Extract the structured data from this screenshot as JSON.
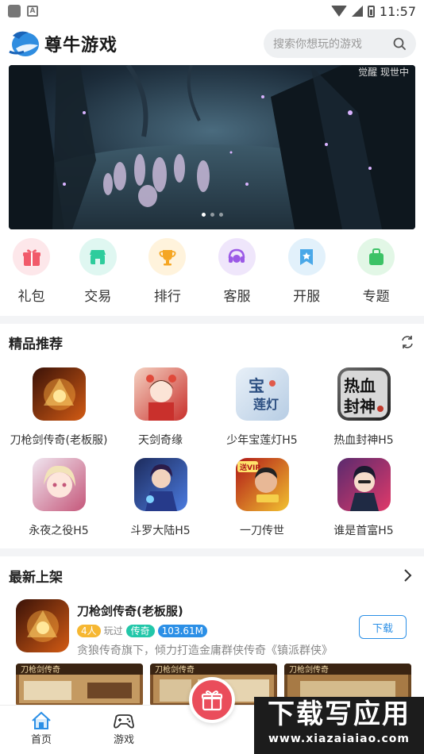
{
  "status_bar": {
    "time": "11:57"
  },
  "header": {
    "app_name": "尊牛游戏",
    "search_placeholder": "搜索你想玩的游戏"
  },
  "banner": {
    "tag": "觉醒 现世中",
    "slide_count": 3,
    "active_slide": 1
  },
  "quick_nav": [
    {
      "label": "礼包",
      "icon": "gift-icon",
      "bg": "#fde7ea",
      "fg": "#f15a6a"
    },
    {
      "label": "交易",
      "icon": "shop-icon",
      "bg": "#dff7f1",
      "fg": "#2ecc9c"
    },
    {
      "label": "排行",
      "icon": "trophy-icon",
      "bg": "#fff3dc",
      "fg": "#f5a623"
    },
    {
      "label": "客服",
      "icon": "headset-icon",
      "bg": "#efe6fb",
      "fg": "#9b59e6"
    },
    {
      "label": "开服",
      "icon": "bookmark-icon",
      "bg": "#e2f1fb",
      "fg": "#4aa8e8"
    },
    {
      "label": "专题",
      "icon": "bag-icon",
      "bg": "#e2f7e6",
      "fg": "#3cc266"
    }
  ],
  "recommended": {
    "title": "精品推荐",
    "games": [
      {
        "name": "刀枪剑传奇(老板服)",
        "colors": [
          "#3a1208",
          "#d35b14"
        ]
      },
      {
        "name": "天剑奇缘",
        "colors": [
          "#f4d2c2",
          "#c9302c"
        ]
      },
      {
        "name": "少年宝莲灯H5",
        "colors": [
          "#e8f0f8",
          "#3c6fb0"
        ]
      },
      {
        "name": "热血封神H5",
        "colors": [
          "#6c6c6c",
          "#1e1e1e"
        ]
      },
      {
        "name": "永夜之役H5",
        "colors": [
          "#f0e6f0",
          "#c5577a"
        ]
      },
      {
        "name": "斗罗大陆H5",
        "colors": [
          "#1d2b5c",
          "#4b7be0"
        ]
      },
      {
        "name": "一刀传世",
        "colors": [
          "#b01818",
          "#f2c230"
        ]
      },
      {
        "name": "谁是首富H5",
        "colors": [
          "#5a2a6e",
          "#e03a6a"
        ]
      }
    ]
  },
  "newest": {
    "title": "最新上架",
    "game": {
      "name": "刀枪剑传奇(老板服)",
      "players": "4人",
      "played": "玩过",
      "genre": "传奇",
      "size": "103.61M",
      "desc": "贪狼传奇旗下，倾力打造金庸群侠传奇《镇派群侠》",
      "download_label": "下载"
    },
    "screenshot_labels": [
      "刀枪剑传奇",
      "刀枪剑传奇",
      "刀枪剑传奇"
    ]
  },
  "bottom_nav": [
    {
      "label": "首页",
      "icon": "home-icon"
    },
    {
      "label": "游戏",
      "icon": "gamepad-icon"
    }
  ],
  "watermark": {
    "line1": "下载写应用",
    "line2": "www.xiazaiaiao.com"
  }
}
